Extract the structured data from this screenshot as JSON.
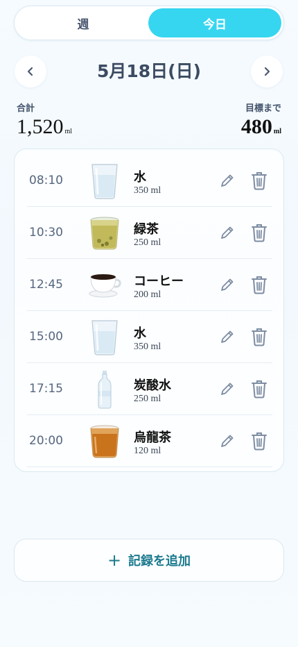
{
  "tabs": {
    "week": "週",
    "today": "今日",
    "active": "today"
  },
  "date_nav": {
    "title": "5月18日(日)",
    "prev_icon": "chevron-left-icon",
    "next_icon": "chevron-right-icon"
  },
  "summary": {
    "total_label": "合計",
    "total_value": "1,520",
    "total_unit": "ml",
    "remaining_label": "目標まで",
    "remaining_value": "480",
    "remaining_unit": "ml"
  },
  "entries": [
    {
      "time": "08:10",
      "name": "水",
      "amount": "350 ml",
      "icon": "water-glass-icon"
    },
    {
      "time": "10:30",
      "name": "緑茶",
      "amount": "250 ml",
      "icon": "green-tea-glass-icon"
    },
    {
      "time": "12:45",
      "name": "コーヒー",
      "amount": "200 ml",
      "icon": "coffee-cup-icon"
    },
    {
      "time": "15:00",
      "name": "水",
      "amount": "350 ml",
      "icon": "water-glass-icon"
    },
    {
      "time": "17:15",
      "name": "炭酸水",
      "amount": "250 ml",
      "icon": "sparkling-water-bottle-icon"
    },
    {
      "time": "20:00",
      "name": "烏龍茶",
      "amount": "120 ml",
      "icon": "oolong-tea-glass-icon"
    }
  ],
  "add_button": {
    "label": "記録を追加",
    "icon": "plus-icon"
  },
  "colors": {
    "accent": "#36d6f0",
    "add_text": "#1b7a8e",
    "icon_gray": "#7d8ca2"
  }
}
